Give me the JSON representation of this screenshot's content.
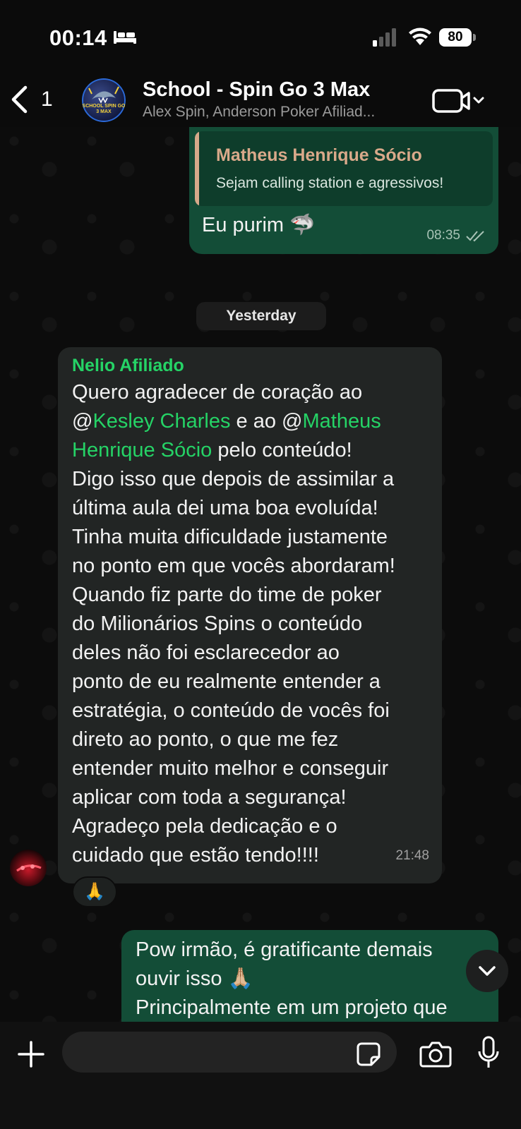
{
  "status_bar": {
    "time": "00:14",
    "battery": "80"
  },
  "header": {
    "back_count": "1",
    "avatar_text": "SCHOOL SPIN GO 3 MAX",
    "title": "School - Spin Go 3 Max",
    "subtitle": "Alex Spin, Anderson Poker Afiliad..."
  },
  "messages": [
    {
      "direction": "outgoing",
      "quote_author": "Matheus Henrique Sócio",
      "quote_text": "Sejam calling station e agressivos!",
      "text": "Eu purim 🦈",
      "time": "08:35",
      "status": "read"
    },
    {
      "direction": "incoming",
      "sender": "Nelio Afiliado",
      "lines": {
        "l1": "Quero agradecer de coração ao",
        "l2_at1": "@",
        "l2_mention": "Kesley Charles",
        "l2_mid": " e ao ",
        "l2_at2": "@",
        "l2_mention2": "Matheus",
        "l3_mention": "Henrique Sócio",
        "l3_rest": " pelo conteúdo!",
        "l4": "Digo isso que depois de assimilar a",
        "l5": "última aula dei uma boa evoluída!",
        "l6": "Tinha muita dificuldade justamente",
        "l7": "no ponto em que vocês abordaram!",
        "l8": "Quando fiz parte do time de poker",
        "l9": "do Milionários Spins o conteúdo",
        "l10": "deles não foi esclarecedor ao",
        "l11": "ponto de eu realmente entender a",
        "l12": "estratégia, o conteúdo de vocês foi",
        "l13": "direto ao ponto, o que me fez",
        "l14": "entender muito melhor e conseguir",
        "l15": "aplicar com toda a segurança!",
        "l16": "Agradeço pela dedicação e o",
        "l17": "cuidado que estão tendo!!!!"
      },
      "time": "21:48",
      "reaction": "🙏"
    },
    {
      "direction": "outgoing",
      "lines": {
        "l1": "Pow irmão, é gratificante demais",
        "l2": "ouvir isso 🙏🏼",
        "l3": "Principalmente em um projeto que"
      }
    }
  ],
  "date_separator": "Yesterday",
  "input": {
    "placeholder": ""
  },
  "colors": {
    "outgoing_bubble": "#134d37",
    "incoming_bubble": "#222524",
    "accent_green": "#25d366",
    "quote_author": "#d9a98a"
  }
}
